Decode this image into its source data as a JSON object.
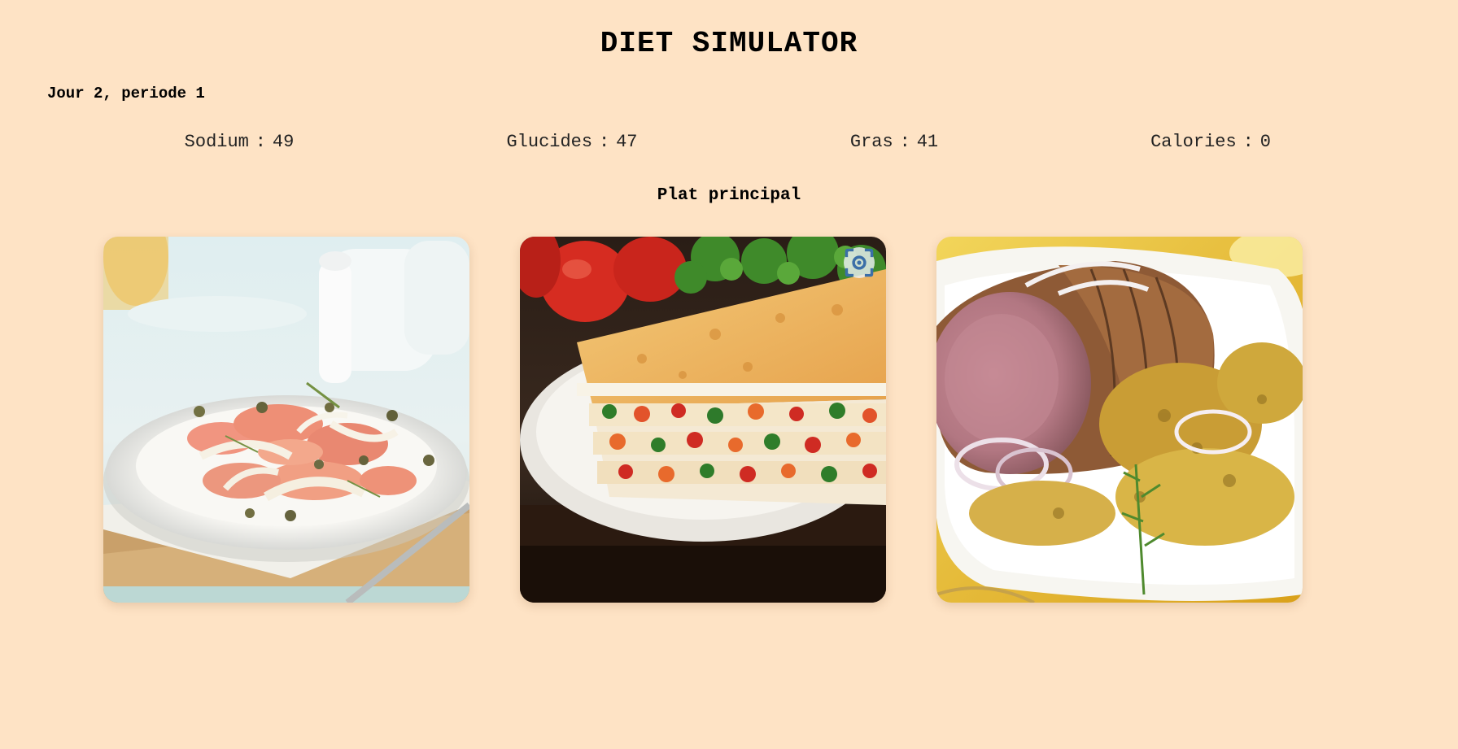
{
  "app": {
    "title": "DIET SIMULATOR",
    "period": "Jour 2, periode 1"
  },
  "stats": [
    {
      "label": "Sodium",
      "separator": ":",
      "value": "49"
    },
    {
      "label": "Glucides",
      "separator": ":",
      "value": "47"
    },
    {
      "label": "Gras",
      "separator": ":",
      "value": "41"
    },
    {
      "label": "Calories",
      "separator": ":",
      "value": "0"
    }
  ],
  "course": {
    "label": "Plat principal"
  },
  "meals": [
    {
      "name": "salmon-fennel-salad",
      "image_alt": "Salade de saumon, fenouil et pamplemousse"
    },
    {
      "name": "vegetable-lasagna",
      "image_alt": "Lasagne aux légumes"
    },
    {
      "name": "roast-pork-rosti",
      "image_alt": "Rôti de porc et galettes de pommes de terre"
    }
  ],
  "icons": {
    "image_search": "image-search-lens-icon"
  },
  "colors": {
    "background": "#fee3c5",
    "text": "#000000"
  }
}
